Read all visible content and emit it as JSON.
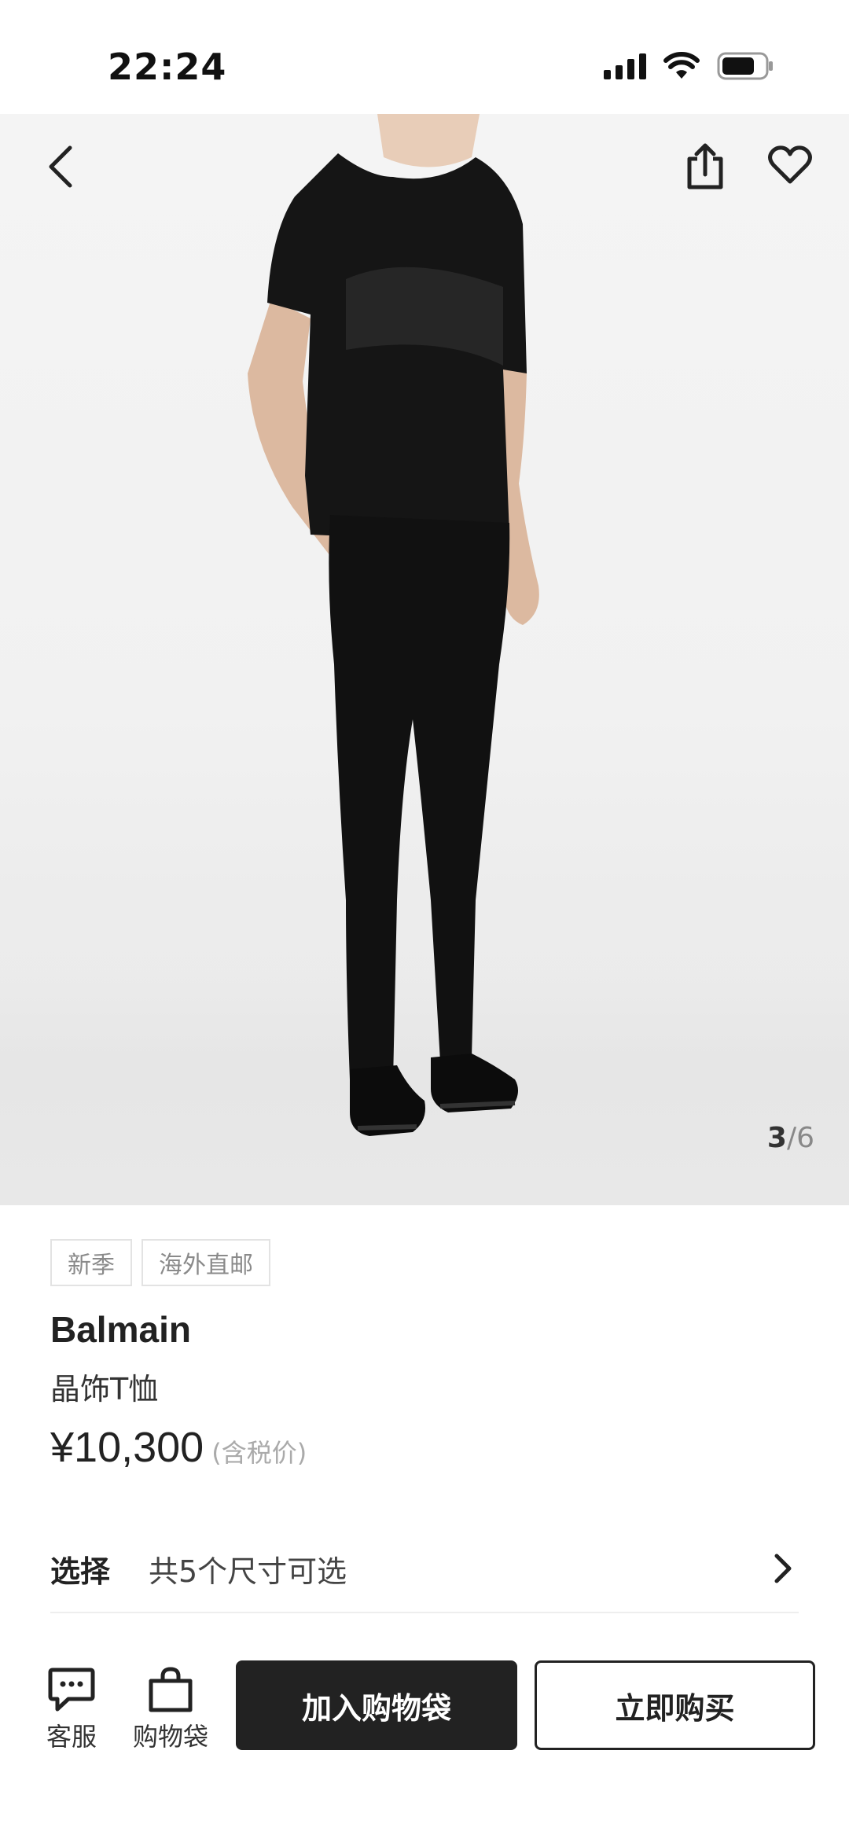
{
  "status_bar": {
    "time": "22:24"
  },
  "gallery": {
    "current": "3",
    "separator": "/",
    "total": "6"
  },
  "product": {
    "tags": [
      "新季",
      "海外直邮"
    ],
    "brand": "Balmain",
    "name": "晶饰T恤",
    "price": "¥10,300",
    "tax_note": "(含税价)"
  },
  "size_select": {
    "label": "选择",
    "value": "共5个尺寸可选"
  },
  "bottom_bar": {
    "service_label": "客服",
    "bag_label": "购物袋",
    "add_to_bag": "加入购物袋",
    "buy_now": "立即购买"
  }
}
